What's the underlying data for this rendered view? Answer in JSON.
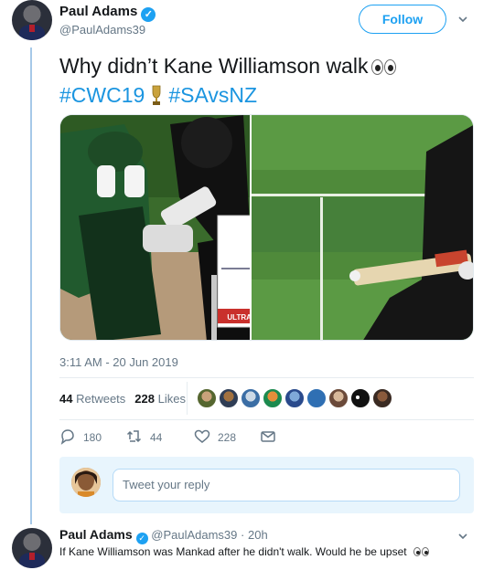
{
  "tweet": {
    "author_name": "Paul Adams",
    "handle": "@PaulAdams39",
    "follow_label": "Follow",
    "text_line1": "Why didn’t Kane Williamson walk",
    "hashtag1": "#CWC19",
    "hashtag2": "#SAvsNZ",
    "media_caption": "ULTRAEDGE",
    "timestamp": "3:11 AM - 20 Jun 2019",
    "retweets_count": "44",
    "retweets_label": "Retweets",
    "likes_count": "228",
    "likes_label": "Likes",
    "replies_action_count": "180",
    "retweets_action_count": "44",
    "likes_action_count": "228",
    "icons": [
      "verified-badge-icon",
      "eyes-emoji-icon",
      "trophy-emoji-icon",
      "chevron-down-icon",
      "reply-icon",
      "retweet-icon",
      "like-icon",
      "message-icon"
    ]
  },
  "reply_box": {
    "placeholder": "Tweet your reply"
  },
  "reply_tweet": {
    "author_name": "Paul Adams",
    "handle": "@PaulAdams39",
    "separator": "·",
    "age": "20h",
    "text": "If Kane Williamson was Mankad after he didn't walk. Would he be upset"
  },
  "colors": {
    "accent": "#1da1f2",
    "hashtag": "#1b95e0",
    "thread_line": "#a6c9e8",
    "muted_text": "#657786",
    "reply_box_bg": "#e8f5fd"
  }
}
